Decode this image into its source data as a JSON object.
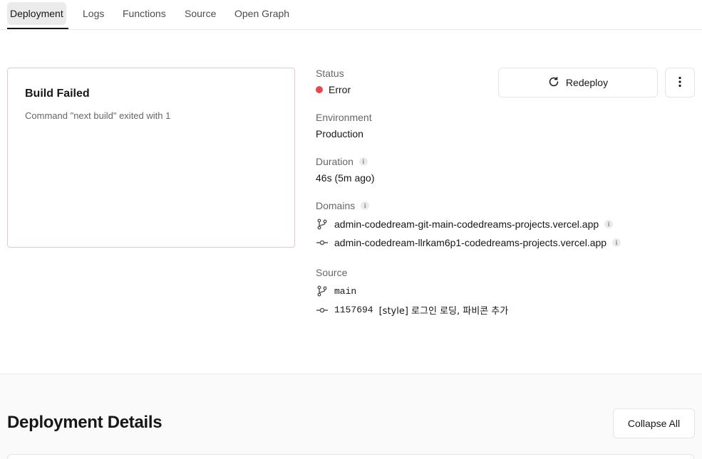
{
  "tabs": [
    {
      "label": "Deployment"
    },
    {
      "label": "Logs"
    },
    {
      "label": "Functions"
    },
    {
      "label": "Source"
    },
    {
      "label": "Open Graph"
    }
  ],
  "build_card": {
    "title": "Build Failed",
    "message": "Command \"next build\" exited with 1"
  },
  "status": {
    "label": "Status",
    "value": "Error",
    "color": "#e5484d"
  },
  "environment": {
    "label": "Environment",
    "value": "Production"
  },
  "duration": {
    "label": "Duration",
    "value": "46s (5m ago)"
  },
  "domains": {
    "label": "Domains",
    "items": [
      {
        "icon": "git-branch-icon",
        "value": "admin-codedream-git-main-codedreams-projects.vercel.app"
      },
      {
        "icon": "git-commit-icon",
        "value": "admin-codedream-llrkam6p1-codedreams-projects.vercel.app"
      }
    ]
  },
  "source": {
    "label": "Source",
    "branch": "main",
    "commit_hash": "1157694",
    "commit_message": "[style] 로그인 로딩, 파비콘 추가"
  },
  "actions": {
    "redeploy_label": "Redeploy",
    "more_icon": "more-vertical-icon"
  },
  "details": {
    "title": "Deployment Details",
    "collapse_label": "Collapse All"
  }
}
